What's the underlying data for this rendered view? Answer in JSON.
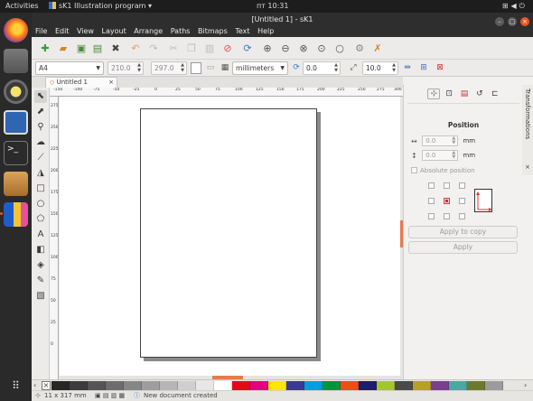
{
  "system": {
    "activities": "Activities",
    "app_name": "sK1 Illustration program",
    "app_menu_arrow": "▾",
    "clock": "пт 10:31",
    "tray": [
      "network-icon",
      "volume-icon",
      "power-icon"
    ]
  },
  "window": {
    "title": "[Untitled 1] - sK1",
    "menu": [
      "File",
      "Edit",
      "View",
      "Layout",
      "Arrange",
      "Paths",
      "Bitmaps",
      "Text",
      "Help"
    ]
  },
  "toolbar": {
    "buttons": [
      "new-icon",
      "open-icon",
      "save-icon",
      "save-as-icon",
      "close-doc-icon",
      "undo-icon",
      "redo-icon",
      "cut-icon",
      "copy-icon",
      "paste-icon",
      "delete-icon",
      "refresh-icon",
      "zoom-in-icon",
      "zoom-out-icon",
      "zoom-page-icon",
      "zoom-fit-icon",
      "zoom-100-icon",
      "snap-icon",
      "properties-icon"
    ]
  },
  "propbar": {
    "page_format": "A4",
    "width": "210.0",
    "height": "297.0",
    "units": "millimeters",
    "rotation": "0.0",
    "nudge": "10.0"
  },
  "document": {
    "tab_label": "Untitled 1",
    "tab_close": "×"
  },
  "rulers": {
    "h_labels": [
      "-150",
      "-100",
      "-75",
      "-50",
      "-25",
      "0",
      "25",
      "50",
      "75",
      "100",
      "125",
      "150",
      "175",
      "200",
      "225",
      "250",
      "275",
      "300"
    ],
    "v_labels": [
      "275",
      "250",
      "225",
      "200",
      "175",
      "150",
      "125",
      "100",
      "75",
      "50",
      "25",
      "0"
    ]
  },
  "docker": {
    "title": "Position",
    "x_value": "0.0",
    "y_value": "0.0",
    "unit": "mm",
    "absolute_position": "Absolute position",
    "apply_to_copy": "Apply to copy",
    "apply": "Apply",
    "side_tab": "Transformations",
    "side_close": "×"
  },
  "palette": {
    "colors": [
      "#262626",
      "#3c3c3c",
      "#555555",
      "#6d6d6d",
      "#868686",
      "#9e9e9e",
      "#b6b6b6",
      "#cfcfcf",
      "#e7e7e7",
      "#ffffff",
      "#e20a17",
      "#e5007e",
      "#ffe600",
      "#3a3b90",
      "#009ee2",
      "#00963e",
      "#e94e1b",
      "#1d1d6a",
      "#a4c532",
      "#4a4a4a",
      "#b9a020",
      "#7a3f8e",
      "#4fa5a2",
      "#6d7a2e",
      "#9b9b9b"
    ]
  },
  "status": {
    "page_size": "11 x 317 mm",
    "message": "New document created"
  }
}
